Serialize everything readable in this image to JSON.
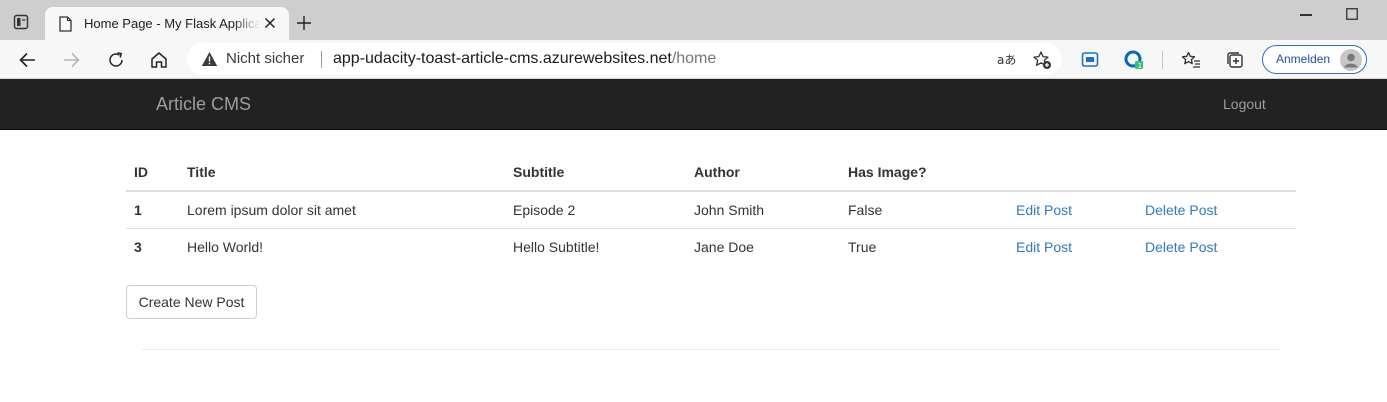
{
  "browser": {
    "tab_title": "Home Page - My Flask Application",
    "security_label": "Nicht sicher",
    "url_host": "app-udacity-toast-article-cms.azurewebsites.net",
    "url_path": "/home",
    "signin_label": "Anmelden",
    "icons": [
      "tab-actions-icon",
      "page-favicon",
      "close-icon",
      "new-tab-icon",
      "minimize-icon",
      "maximize-icon",
      "back-icon",
      "forward-icon",
      "refresh-icon",
      "home-icon",
      "warning-icon",
      "read-aloud-icon",
      "add-favorite-icon",
      "browser-essentials-icon",
      "extension-icon",
      "favorites-icon",
      "collections-icon",
      "avatar"
    ]
  },
  "navbar": {
    "brand": "Article CMS",
    "logout": "Logout"
  },
  "table": {
    "headers": [
      "ID",
      "Title",
      "Subtitle",
      "Author",
      "Has Image?",
      "",
      ""
    ],
    "rows": [
      {
        "id": "1",
        "title": "Lorem ipsum dolor sit amet",
        "subtitle": "Episode 2",
        "author": "John Smith",
        "has_image": "False",
        "edit": "Edit Post",
        "delete": "Delete Post"
      },
      {
        "id": "3",
        "title": "Hello World!",
        "subtitle": "Hello Subtitle!",
        "author": "Jane Doe",
        "has_image": "True",
        "edit": "Edit Post",
        "delete": "Delete Post"
      }
    ]
  },
  "actions": {
    "create_label": "Create New Post"
  },
  "colors": {
    "navbar_bg": "#222222",
    "nav_text": "#9d9d9d",
    "link": "#337ab7"
  }
}
